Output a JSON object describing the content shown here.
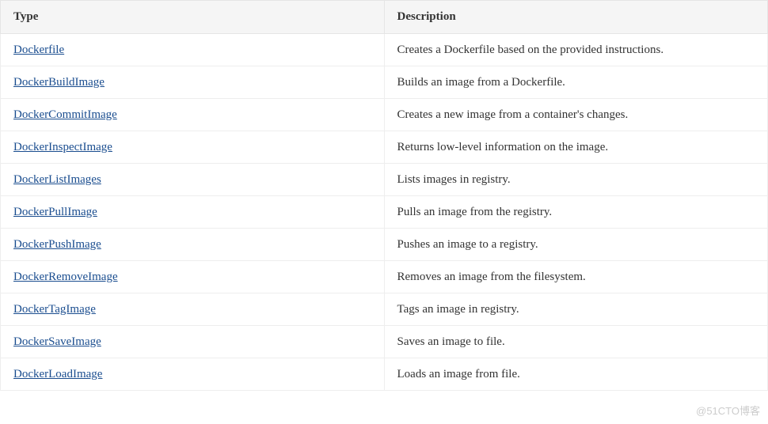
{
  "table": {
    "headers": {
      "type": "Type",
      "description": "Description"
    },
    "rows": [
      {
        "type": "Dockerfile",
        "description": "Creates a Dockerfile based on the provided instructions."
      },
      {
        "type": "DockerBuildImage",
        "description": "Builds an image from a Dockerfile."
      },
      {
        "type": "DockerCommitImage",
        "description": "Creates a new image from a container's changes."
      },
      {
        "type": "DockerInspectImage",
        "description": "Returns low-level information on the image."
      },
      {
        "type": "DockerListImages",
        "description": "Lists images in registry."
      },
      {
        "type": "DockerPullImage",
        "description": "Pulls an image from the registry."
      },
      {
        "type": "DockerPushImage",
        "description": "Pushes an image to a registry."
      },
      {
        "type": "DockerRemoveImage",
        "description": "Removes an image from the filesystem."
      },
      {
        "type": "DockerTagImage",
        "description": "Tags an image in registry."
      },
      {
        "type": "DockerSaveImage",
        "description": "Saves an image to file."
      },
      {
        "type": "DockerLoadImage",
        "description": "Loads an image from file."
      }
    ]
  },
  "watermark": "@51CTO博客"
}
